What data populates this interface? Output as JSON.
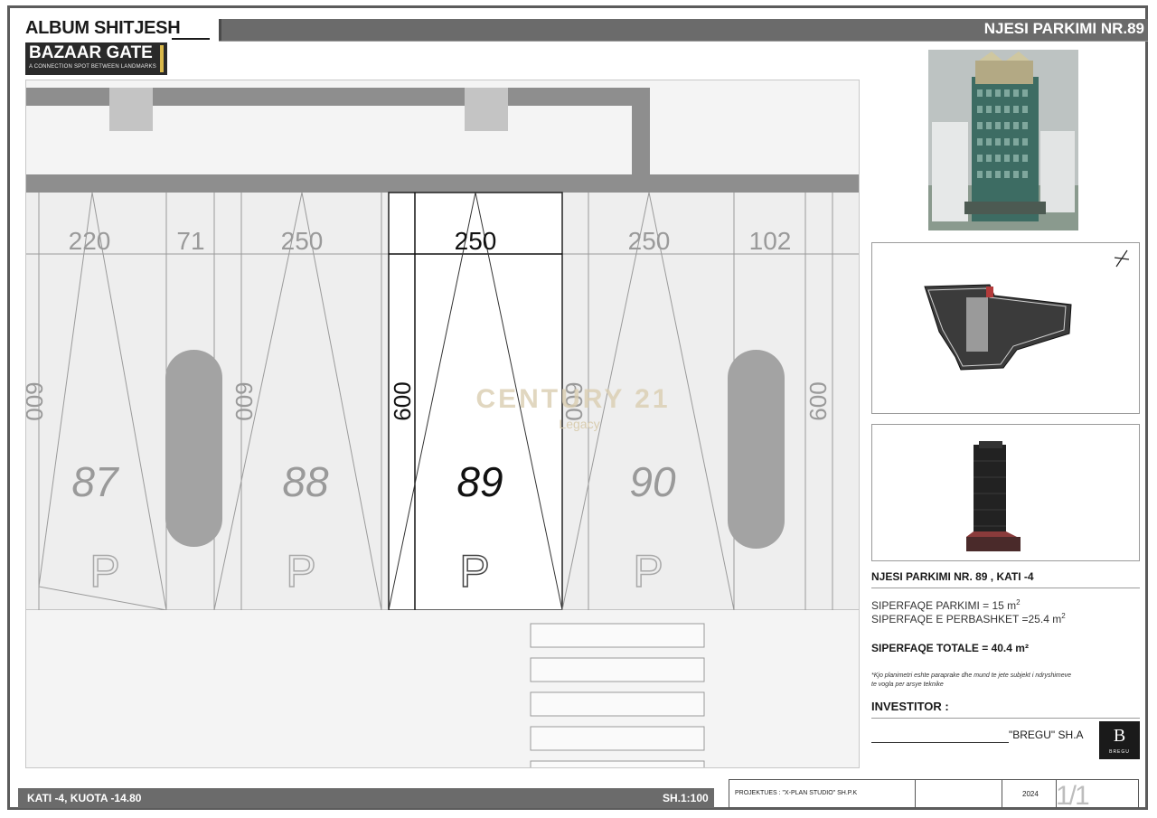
{
  "header": {
    "album_title": "ALBUM SHITJESH",
    "logo_name": "BAZAAR GATE",
    "logo_tagline": "A CONNECTION SPOT BETWEEN LANDMARKS",
    "unit_heading": "NJESI PARKIMI NR.89"
  },
  "plan": {
    "spots": [
      {
        "number": "87",
        "width_label": "220",
        "sign": "P"
      },
      {
        "number": "88",
        "width_label": "250",
        "sign": "P"
      },
      {
        "number": "89",
        "width_label": "250",
        "sign": "P"
      },
      {
        "number": "90",
        "width_label": "250",
        "sign": "P"
      }
    ],
    "gap_labels": [
      "71",
      "102"
    ],
    "depth_label": "600",
    "left_edge_label": "600",
    "watermark_brand": "CENTURY 21",
    "watermark_sub": "Legacy"
  },
  "info": {
    "unit_title": "NJESI PARKIMI NR. 89 , KATI -4",
    "parking_area": "SIPERFAQE PARKIMI = 15 m",
    "parking_sup": "2",
    "shared_area": "SIPERFAQE E PERBASHKET =25.4 m",
    "shared_sup": "2",
    "total_area": "SIPERFAQE TOTALE = 40.4 m²",
    "note_line1": "*Kjo planimetri eshte paraprake dhe mund te jete subjekt i ndryshimeve",
    "note_line2": "te vogla per arsye teknike",
    "investitor_label": "INVESTITOR :",
    "investor_name": "\"BREGU\" SH.A",
    "investor_logo_text": "B",
    "investor_logo_sub": "BREGU"
  },
  "footer": {
    "level": "KATI -4, KUOTA -14.80",
    "scale": "SH.1:100",
    "designer": "PROJEKTUES : \"X-PLAN STUDIO\" SH.P.K",
    "year": "2024",
    "sheet": "1/1"
  }
}
